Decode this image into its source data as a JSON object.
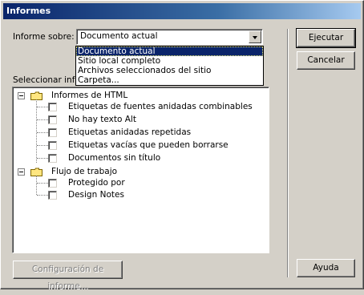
{
  "window": {
    "title": "Informes"
  },
  "report_on": {
    "label": "Informe sobre:",
    "selected": "Documento actual",
    "options": [
      "Documento actual",
      "Sitio local completo",
      "Archivos seleccionados del sitio",
      "Carpeta..."
    ]
  },
  "select_reports_label": "Seleccionar infor",
  "tree": {
    "groups": [
      {
        "label": "Informes de HTML",
        "items": [
          "Etiquetas de fuentes anidadas combinables",
          "No hay texto Alt",
          "Etiquetas anidadas repetidas",
          "Etiquetas vacías que pueden borrarse",
          "Documentos sin título"
        ]
      },
      {
        "label": "Flujo de trabajo",
        "items": [
          "Protegido por",
          "Design Notes"
        ]
      }
    ]
  },
  "buttons": {
    "run": "Ejecutar",
    "cancel": "Cancelar",
    "help": "Ayuda",
    "settings": "Configuración de informe..."
  },
  "colors": {
    "title_bar": "#0a246a",
    "dialog_bg": "#d4d0c8",
    "selection": "#0a246a"
  }
}
